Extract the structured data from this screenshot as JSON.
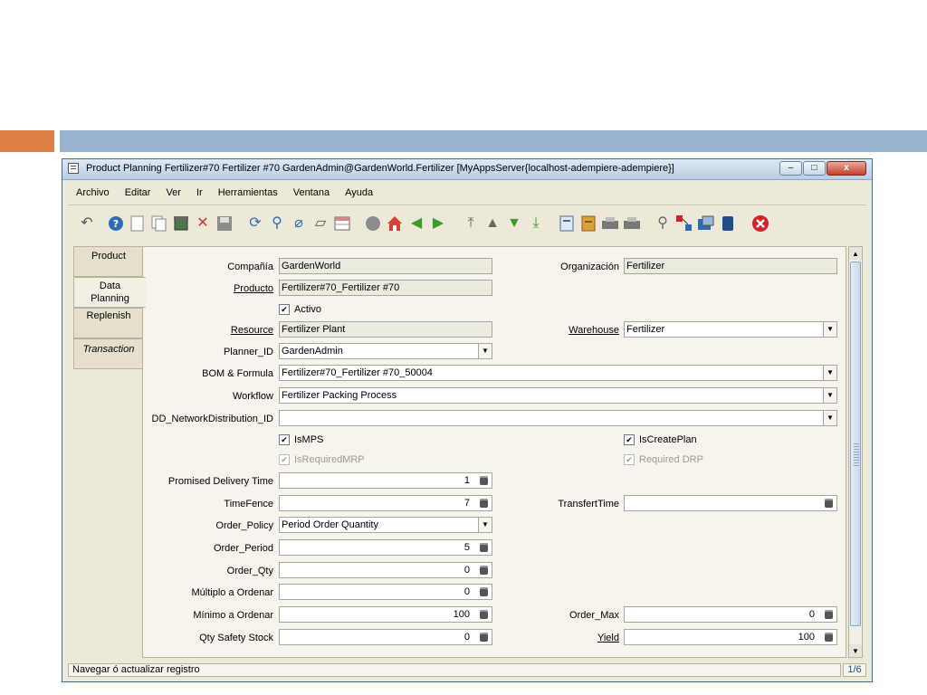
{
  "slide": {
    "accent_orange": "#dd8047",
    "accent_blue": "#98b3cf"
  },
  "window": {
    "title": "Product Planning  Fertilizer#70  Fertilizer #70  GardenAdmin@GardenWorld.Fertilizer [MyAppsServer{localhost-adempiere-adempiere}]",
    "minimize": "–",
    "maximize": "□",
    "close": "x"
  },
  "menu": [
    "Archivo",
    "Editar",
    "Ver",
    "Ir",
    "Herramientas",
    "Ventana",
    "Ayuda"
  ],
  "toolbar": [
    "undo-icon",
    "help-icon",
    "new-record-icon",
    "copy-record-icon",
    "delete-icon",
    "delete-selection-icon",
    "save-icon",
    "refresh-icon",
    "find-icon",
    "attachment-icon",
    "chat-icon",
    "grid-toggle-icon",
    "history-icon",
    "home-icon",
    "back-icon",
    "forward-icon",
    "first-record-icon",
    "previous-record-icon",
    "next-record-icon",
    "last-record-icon",
    "report-icon",
    "archive-icon",
    "print-preview-icon",
    "print-icon",
    "zoom-across-icon",
    "active-workflows-icon",
    "requests-icon",
    "product-info-icon",
    "exit-icon"
  ],
  "tabs": [
    {
      "label": "Product"
    },
    {
      "label": "Data\nPlanning"
    },
    {
      "label": "Replenish"
    },
    {
      "label": "Transaction"
    }
  ],
  "form": {
    "compania": {
      "label": "Compañía",
      "value": "GardenWorld"
    },
    "organizacion": {
      "label": "Organización",
      "value": "Fertilizer"
    },
    "producto": {
      "label": "Producto",
      "value": "Fertilizer#70_Fertilizer #70"
    },
    "activo": {
      "label": "Activo",
      "checked": true
    },
    "resource": {
      "label": "Resource",
      "value": "Fertilizer Plant"
    },
    "warehouse": {
      "label": "Warehouse",
      "value": "Fertilizer"
    },
    "planner": {
      "label": "Planner_ID",
      "value": "GardenAdmin"
    },
    "bom": {
      "label": "BOM & Formula",
      "value": "Fertilizer#70_Fertilizer #70_50004"
    },
    "workflow": {
      "label": "Workflow",
      "value": "Fertilizer Packing Process"
    },
    "dd_network": {
      "label": "DD_NetworkDistribution_ID",
      "value": ""
    },
    "ismps": {
      "label": "IsMPS",
      "checked": true
    },
    "iscreateplan": {
      "label": "IsCreatePlan",
      "checked": true
    },
    "isrequiredmrp": {
      "label": "IsRequiredMRP",
      "checked": true
    },
    "requireddrp": {
      "label": "Required DRP",
      "checked": true
    },
    "promised_delivery": {
      "label": "Promised Delivery Time",
      "value": "1"
    },
    "timefence": {
      "label": "TimeFence",
      "value": "7"
    },
    "transfert": {
      "label": "TransfertTime",
      "value": ""
    },
    "order_policy": {
      "label": "Order_Policy",
      "value": "Period Order Quantity"
    },
    "order_period": {
      "label": "Order_Period",
      "value": "5"
    },
    "order_qty": {
      "label": "Order_Qty",
      "value": "0"
    },
    "multiplo": {
      "label": "Múltiplo a Ordenar",
      "value": "0"
    },
    "minimo": {
      "label": "Mínimo a Ordenar",
      "value": "100"
    },
    "order_max": {
      "label": "Order_Max",
      "value": "0"
    },
    "qty_safety": {
      "label": "Qty Safety Stock",
      "value": "0"
    },
    "yield": {
      "label": "Yield",
      "value": "100"
    }
  },
  "status": {
    "message": "Navegar ó actualizar registro",
    "count": "1/6"
  }
}
